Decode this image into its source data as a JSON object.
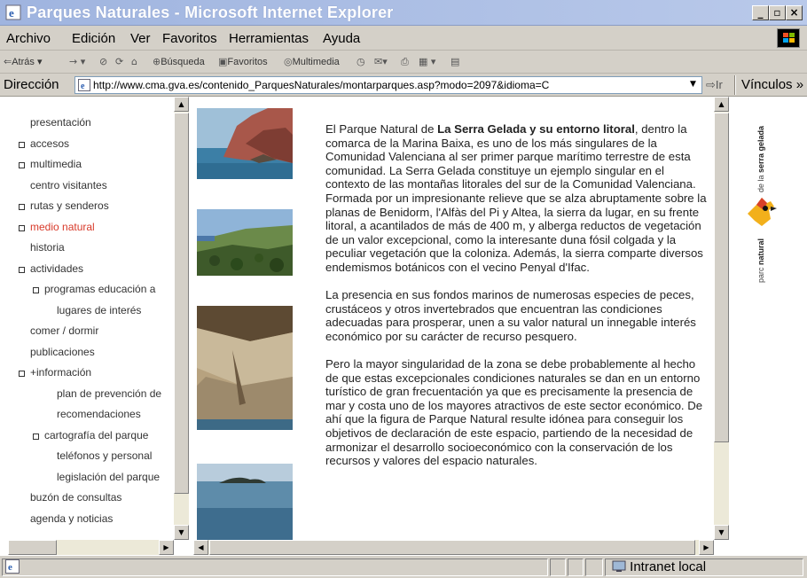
{
  "window": {
    "title": "Parques Naturales - Microsoft Internet Explorer",
    "controls": {
      "minimize": "_",
      "maximize": "▫",
      "close": "×"
    }
  },
  "menu": [
    "Archivo",
    "Edición",
    "Ver",
    "Favoritos",
    "Herramientas",
    "Ayuda"
  ],
  "toolbar": {
    "back": "Atrás",
    "search": "Búsqueda",
    "favorites": "Favoritos",
    "multimedia": "Multimedia"
  },
  "address": {
    "label": "Dirección",
    "url": "http://www.cma.gva.es/contenido_ParquesNaturales/montarparques.asp?modo=2097&idioma=C",
    "go": "Ir",
    "links": "Vínculos"
  },
  "nav": [
    {
      "label": "presentación",
      "bullet": false,
      "indent": 0,
      "active": false
    },
    {
      "label": "accesos",
      "bullet": true,
      "indent": 0,
      "active": false
    },
    {
      "label": "multimedia",
      "bullet": true,
      "indent": 0,
      "active": false
    },
    {
      "label": "centro visitantes",
      "bullet": false,
      "indent": 0,
      "active": false
    },
    {
      "label": "rutas y senderos",
      "bullet": true,
      "indent": 0,
      "active": false
    },
    {
      "label": "medio natural",
      "bullet": true,
      "indent": 0,
      "active": true
    },
    {
      "label": "historia",
      "bullet": false,
      "indent": 0,
      "active": false
    },
    {
      "label": "actividades",
      "bullet": true,
      "indent": 0,
      "active": false
    },
    {
      "label": "programas educación a",
      "bullet": true,
      "indent": 1,
      "active": false
    },
    {
      "label": "lugares de interés",
      "bullet": false,
      "indent": 1,
      "active": false
    },
    {
      "label": "comer / dormir",
      "bullet": false,
      "indent": 0,
      "active": false
    },
    {
      "label": "publicaciones",
      "bullet": false,
      "indent": 0,
      "active": false
    },
    {
      "label": "+información",
      "bullet": true,
      "indent": 0,
      "active": false
    },
    {
      "label": "plan de prevención de",
      "bullet": false,
      "indent": 1,
      "active": false
    },
    {
      "label": "recomendaciones",
      "bullet": false,
      "indent": 1,
      "active": false
    },
    {
      "label": "cartografía del parque",
      "bullet": true,
      "indent": 1,
      "active": false
    },
    {
      "label": "teléfonos y personal",
      "bullet": false,
      "indent": 1,
      "active": false
    },
    {
      "label": "legislación del parque",
      "bullet": false,
      "indent": 1,
      "active": false
    },
    {
      "label": "buzón de consultas",
      "bullet": false,
      "indent": 0,
      "active": false
    },
    {
      "label": "agenda y noticias",
      "bullet": false,
      "indent": 0,
      "active": false
    }
  ],
  "article": {
    "p1_pre": "El Parque Natural de ",
    "p1_bold": "La Serra Gelada y su entorno litoral",
    "p1_post": ", dentro la comarca de la Marina Baixa, es uno de los más singulares de la Comunidad Valenciana al ser primer parque marítimo terrestre de esta comunidad. La Serra Gelada constituye un ejemplo singular en el contexto de las montañas litorales del sur de la Comunidad Valenciana. Formada por un impresionante relieve que se alza abruptamente sobre la planas de Benidorm, l'Alfàs del Pi y Altea, la sierra da lugar, en su frente litoral, a acantilados de más de 400 m, y alberga reductos de vegetación de un valor excepcional, como la interesante duna fósil colgada y la peculiar vegetación que la coloniza. Además, la sierra comparte diversos endemismos botánicos con el vecino Penyal d'Ifac.",
    "p2": "La presencia en sus fondos marinos de numerosas especies de peces, crustáceos y otros invertebrados que encuentran las condiciones adecuadas para prosperar, unen a su valor natural un innegable interés económico por su carácter de recurso pesquero.",
    "p3": "Pero la mayor singularidad de la zona se debe probablemente al hecho de que estas excepcionales condiciones naturales se dan en un entorno turístico de gran frecuentación ya que es precisamente la presencia de mar y costa uno de los mayores atractivos de este sector económico. De ahí que la figura de Parque Natural resulte idónea para conseguir los objetivos de declaración de este espacio, partiendo de la necesidad de armonizar el desarrollo socioeconómico con la conservación de los recursos y valores del espacio naturales."
  },
  "logo": {
    "top_text": "de la serra gelada",
    "top_bold": "serra gelada",
    "top_light": "de la ",
    "bottom_light": "parc ",
    "bottom_bold": "natural"
  },
  "status": {
    "zone": "Intranet local"
  },
  "icons": [
    "ie-page-icon",
    "windows-logo-icon",
    "back-arrow-icon",
    "forward-arrow-icon",
    "stop-icon",
    "refresh-icon",
    "home-icon",
    "search-icon",
    "favorites-icon",
    "multimedia-icon",
    "history-icon",
    "mail-icon",
    "print-icon",
    "edit-icon",
    "go-arrow-icon",
    "intranet-zone-icon"
  ]
}
